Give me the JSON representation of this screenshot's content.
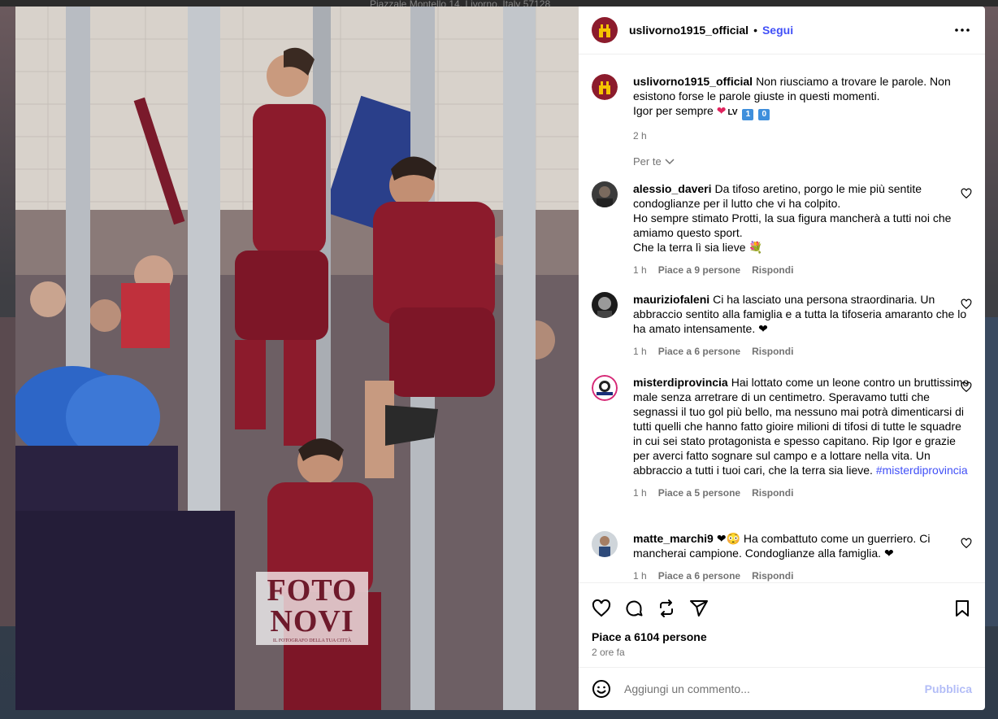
{
  "background": {
    "caption": "Piazzale Montello 14, Livorno, Italy 57128"
  },
  "photo": {
    "alt": "Foto",
    "watermark_line1": "FOTO",
    "watermark_line2": "NOVI",
    "watermark_tag": "IL FOTOGRAFO DELLA TUA CITTÀ"
  },
  "header": {
    "username": "uslivorno1915_official",
    "separator": "•",
    "follow_label": "Segui",
    "more_icon": "more-horizontal-icon"
  },
  "caption": {
    "username": "uslivorno1915_official",
    "text": "Non riusciamo a trovare le parole. Non esistono forse le parole giuste in questi momenti.",
    "line2": "Igor per sempre",
    "emoji_heart": "❤",
    "emoji_lv": "LV",
    "emoji_one": "1",
    "emoji_zero": "0",
    "time": "2 h"
  },
  "sort_label": "Per te",
  "comments": [
    {
      "username": "alessio_daveri",
      "text": "Da tifoso aretino, porgo le mie più sentite condoglianze per il lutto che vi ha colpito.\nHo sempre stimato Protti, la sua figura mancherà a tutti noi che amiamo questo sport.\nChe la terra lì sia lieve 💐",
      "time": "1 h",
      "likes": "Piace a 9 persone",
      "reply": "Rispondi"
    },
    {
      "username": "mauriziofaleni",
      "text": "Ci ha lasciato una persona straordinaria. Un abbraccio sentito alla famiglia e a tutta la tifoseria amaranto che lo ha amato intensamente. ❤",
      "time": "1 h",
      "likes": "Piace a 6 persone",
      "reply": "Rispondi"
    },
    {
      "username": "misterdiprovincia",
      "text": "Hai lottato come un leone contro un bruttissimo male senza arretrare di un centimetro. Speravamo tutti che segnassi il tuo gol più bello, ma nessuno mai potrà dimenticarsi di tutti quelli che hanno fatto gioire milioni di tifosi di tutte le squadre in cui sei stato protagonista e spesso capitano. Rip Igor e grazie per averci fatto sognare sul campo e a lottare nella vita. Un abbraccio a tutti i tuoi cari, che la terra sia lieve.",
      "hashtag": "#misterdiprovincia",
      "time": "1 h",
      "likes": "Piace a 5 persone",
      "reply": "Rispondi"
    },
    {
      "username": "matte_marchi9",
      "text": "❤😳 Ha combattuto come un guerriero. Ci mancherai campione. Condoglianze alla famiglia. ❤",
      "time": "1 h",
      "likes": "Piace a 6 persone",
      "reply": "Rispondi"
    }
  ],
  "footer": {
    "likes_text": "Piace a 6104 persone",
    "time_ago": "2 ore fa",
    "comment_placeholder": "Aggiungi un commento...",
    "publish_label": "Pubblica"
  },
  "colors": {
    "link_blue": "#4150f7",
    "publish_disabled": "#b3bdf7",
    "amaranto": "#8c1b2c",
    "meta_gray": "#737373"
  }
}
